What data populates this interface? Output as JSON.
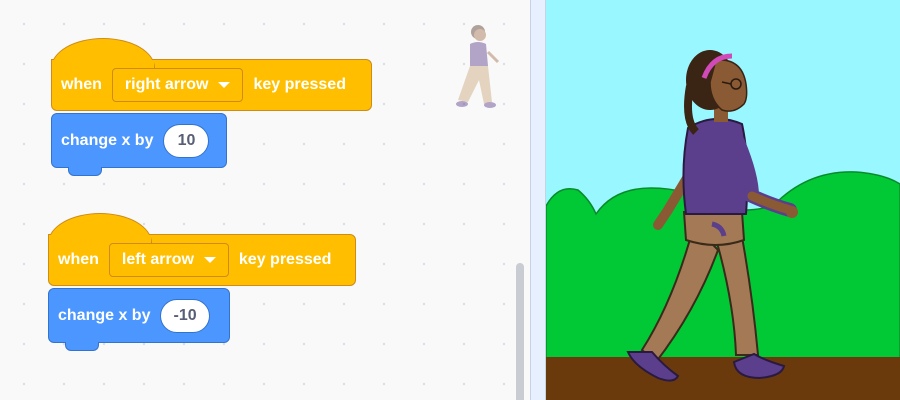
{
  "scripts": [
    {
      "event": {
        "when_label": "when",
        "key_option": "right arrow",
        "suffix_label": "key pressed"
      },
      "command": {
        "label": "change x by",
        "value": "10"
      }
    },
    {
      "event": {
        "when_label": "when",
        "key_option": "left arrow",
        "suffix_label": "key pressed"
      },
      "command": {
        "label": "change x by",
        "value": "-10"
      }
    }
  ],
  "colors": {
    "events_block": "#ffbf00",
    "events_border": "#cf8b17",
    "motion_block": "#4c97ff",
    "motion_border": "#3373cc",
    "stage_sky": "#99f7ff",
    "stage_hills": "#00c935",
    "stage_ground": "#6b3a0c"
  },
  "stage": {
    "sprite_icon": "walking-person-sprite",
    "backdrop_icon": "hills-backdrop"
  }
}
